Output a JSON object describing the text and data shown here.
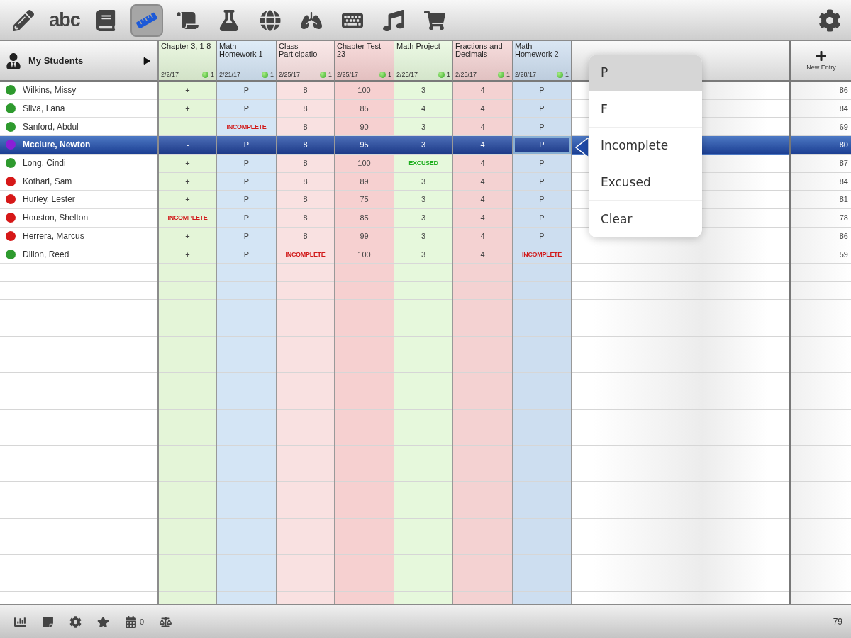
{
  "toolbar": {
    "tools": [
      {
        "selected": false
      },
      {
        "label": "abc",
        "selected": false
      },
      {
        "selected": false
      },
      {
        "selected": true
      },
      {
        "selected": false
      },
      {
        "selected": false
      },
      {
        "selected": false
      },
      {
        "selected": false
      },
      {
        "selected": false
      },
      {
        "selected": false
      },
      {
        "selected": false
      }
    ]
  },
  "students_header": {
    "label": "My Students"
  },
  "columns": [
    {
      "title": "Chapter 3, 1-8",
      "date": "2/2/17",
      "count": "1",
      "color": "#e4f5d8"
    },
    {
      "title": "Math Homework 1",
      "date": "2/21/17",
      "count": "1",
      "color": "#d4e5f5"
    },
    {
      "title": "Class Participatio",
      "date": "2/25/17",
      "count": "1",
      "color": "#f9e1e1"
    },
    {
      "title": "Chapter Test 23",
      "date": "2/25/17",
      "count": "1",
      "color": "#f6d0d0"
    },
    {
      "title": "Math Project",
      "date": "2/25/17",
      "count": "1",
      "color": "#e6f8dc"
    },
    {
      "title": "Fractions and Decimals",
      "date": "2/25/17",
      "count": "1",
      "color": "#f4d2d2"
    },
    {
      "title": "Math Homework 2",
      "date": "2/28/17",
      "count": "1",
      "color": "#cddef0"
    }
  ],
  "new_entry": {
    "label": "New Entry"
  },
  "rows": [
    {
      "name": "Wilkins, Missy",
      "color": "#2e9a2e",
      "selected": false,
      "total": "86",
      "cells": [
        {
          "text": "+",
          "kind": "value",
          "selected": false
        },
        {
          "text": "P",
          "kind": "value",
          "selected": false
        },
        {
          "text": "8",
          "kind": "value",
          "selected": false
        },
        {
          "text": "100",
          "kind": "value",
          "selected": false
        },
        {
          "text": "3",
          "kind": "value",
          "selected": false
        },
        {
          "text": "4",
          "kind": "value",
          "selected": false
        },
        {
          "text": "P",
          "kind": "value",
          "selected": false
        }
      ]
    },
    {
      "name": "Silva, Lana",
      "color": "#2e9a2e",
      "selected": false,
      "total": "84",
      "cells": [
        {
          "text": "+",
          "kind": "value",
          "selected": false
        },
        {
          "text": "P",
          "kind": "value",
          "selected": false
        },
        {
          "text": "8",
          "kind": "value",
          "selected": false
        },
        {
          "text": "85",
          "kind": "value",
          "selected": false
        },
        {
          "text": "4",
          "kind": "value",
          "selected": false
        },
        {
          "text": "4",
          "kind": "value",
          "selected": false
        },
        {
          "text": "P",
          "kind": "value",
          "selected": false
        }
      ]
    },
    {
      "name": "Sanford, Abdul",
      "color": "#2e9a2e",
      "selected": false,
      "total": "69",
      "cells": [
        {
          "text": "-",
          "kind": "value",
          "selected": false
        },
        {
          "text": "INCOMPLETE",
          "kind": "incomplete",
          "selected": false
        },
        {
          "text": "8",
          "kind": "value",
          "selected": false
        },
        {
          "text": "90",
          "kind": "value",
          "selected": false
        },
        {
          "text": "3",
          "kind": "value",
          "selected": false
        },
        {
          "text": "4",
          "kind": "value",
          "selected": false
        },
        {
          "text": "P",
          "kind": "value",
          "selected": false
        }
      ]
    },
    {
      "name": "Mcclure, Newton",
      "color": "#8a1fd6",
      "selected": true,
      "total": "80",
      "cells": [
        {
          "text": "-",
          "kind": "value",
          "selected": false
        },
        {
          "text": "P",
          "kind": "value",
          "selected": false
        },
        {
          "text": "8",
          "kind": "value",
          "selected": false
        },
        {
          "text": "95",
          "kind": "value",
          "selected": false
        },
        {
          "text": "3",
          "kind": "value",
          "selected": false
        },
        {
          "text": "4",
          "kind": "value",
          "selected": false
        },
        {
          "text": "P",
          "kind": "value",
          "selected": true
        }
      ]
    },
    {
      "name": "Long, Cindi",
      "color": "#2e9a2e",
      "selected": false,
      "total": "87",
      "cells": [
        {
          "text": "+",
          "kind": "value",
          "selected": false
        },
        {
          "text": "P",
          "kind": "value",
          "selected": false
        },
        {
          "text": "8",
          "kind": "value",
          "selected": false
        },
        {
          "text": "100",
          "kind": "value",
          "selected": false
        },
        {
          "text": "EXCUSED",
          "kind": "excused",
          "selected": false
        },
        {
          "text": "4",
          "kind": "value",
          "selected": false
        },
        {
          "text": "P",
          "kind": "value",
          "selected": false
        }
      ]
    },
    {
      "name": "Kothari, Sam",
      "color": "#d61818",
      "selected": false,
      "total": "84",
      "cells": [
        {
          "text": "+",
          "kind": "value",
          "selected": false
        },
        {
          "text": "P",
          "kind": "value",
          "selected": false
        },
        {
          "text": "8",
          "kind": "value",
          "selected": false
        },
        {
          "text": "89",
          "kind": "value",
          "selected": false
        },
        {
          "text": "3",
          "kind": "value",
          "selected": false
        },
        {
          "text": "4",
          "kind": "value",
          "selected": false
        },
        {
          "text": "P",
          "kind": "value",
          "selected": false
        }
      ]
    },
    {
      "name": "Hurley, Lester",
      "color": "#d61818",
      "selected": false,
      "total": "81",
      "cells": [
        {
          "text": "+",
          "kind": "value",
          "selected": false
        },
        {
          "text": "P",
          "kind": "value",
          "selected": false
        },
        {
          "text": "8",
          "kind": "value",
          "selected": false
        },
        {
          "text": "75",
          "kind": "value",
          "selected": false
        },
        {
          "text": "3",
          "kind": "value",
          "selected": false
        },
        {
          "text": "4",
          "kind": "value",
          "selected": false
        },
        {
          "text": "P",
          "kind": "value",
          "selected": false
        }
      ]
    },
    {
      "name": "Houston, Shelton",
      "color": "#d61818",
      "selected": false,
      "total": "78",
      "cells": [
        {
          "text": "INCOMPLETE",
          "kind": "incomplete",
          "selected": false
        },
        {
          "text": "P",
          "kind": "value",
          "selected": false
        },
        {
          "text": "8",
          "kind": "value",
          "selected": false
        },
        {
          "text": "85",
          "kind": "value",
          "selected": false
        },
        {
          "text": "3",
          "kind": "value",
          "selected": false
        },
        {
          "text": "4",
          "kind": "value",
          "selected": false
        },
        {
          "text": "P",
          "kind": "value",
          "selected": false
        }
      ]
    },
    {
      "name": "Herrera, Marcus",
      "color": "#d61818",
      "selected": false,
      "total": "86",
      "cells": [
        {
          "text": "+",
          "kind": "value",
          "selected": false
        },
        {
          "text": "P",
          "kind": "value",
          "selected": false
        },
        {
          "text": "8",
          "kind": "value",
          "selected": false
        },
        {
          "text": "99",
          "kind": "value",
          "selected": false
        },
        {
          "text": "3",
          "kind": "value",
          "selected": false
        },
        {
          "text": "4",
          "kind": "value",
          "selected": false
        },
        {
          "text": "P",
          "kind": "value",
          "selected": false
        }
      ]
    },
    {
      "name": "Dillon, Reed",
      "color": "#2e9a2e",
      "selected": false,
      "total": "59",
      "cells": [
        {
          "text": "+",
          "kind": "value",
          "selected": false
        },
        {
          "text": "P",
          "kind": "value",
          "selected": false
        },
        {
          "text": "INCOMPLETE",
          "kind": "incomplete",
          "selected": false
        },
        {
          "text": "100",
          "kind": "value",
          "selected": false
        },
        {
          "text": "3",
          "kind": "value",
          "selected": false
        },
        {
          "text": "4",
          "kind": "value",
          "selected": false
        },
        {
          "text": "INCOMPLETE",
          "kind": "incomplete",
          "selected": false
        }
      ]
    }
  ],
  "popover": {
    "options": [
      {
        "label": "P",
        "selected": true
      },
      {
        "label": "F",
        "selected": false
      },
      {
        "label": "Incomplete",
        "selected": false
      },
      {
        "label": "Excused",
        "selected": false
      },
      {
        "label": "Clear",
        "selected": false
      }
    ]
  },
  "footer": {
    "calendar_count": "0",
    "average": "79"
  }
}
